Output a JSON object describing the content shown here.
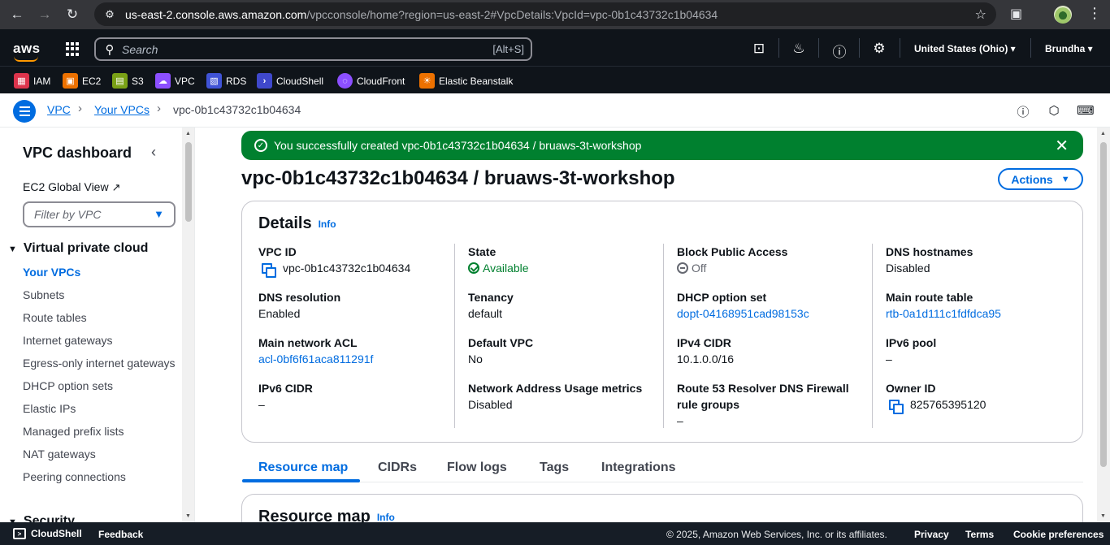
{
  "browser": {
    "url_host": "us-east-2.console.aws.amazon.com",
    "url_rest": "/vpcconsole/home?region=us-east-2#VpcDetails:VpcId=vpc-0b1c43732c1b04634"
  },
  "topnav": {
    "logo": "aws",
    "search_placeholder": "Search",
    "search_shortcut": "[Alt+S]",
    "region": "United States (Ohio)",
    "user": "Brundha"
  },
  "favorites": [
    {
      "label": "IAM",
      "color": "#dd344c",
      "icon": "iam-icon"
    },
    {
      "label": "EC2",
      "color": "#ed7100",
      "icon": "ec2-icon"
    },
    {
      "label": "S3",
      "color": "#7aa116",
      "icon": "s3-icon"
    },
    {
      "label": "VPC",
      "color": "#8c4fff",
      "icon": "vpc-icon"
    },
    {
      "label": "RDS",
      "color": "#4053d6",
      "icon": "rds-icon"
    },
    {
      "label": "CloudShell",
      "color": "#3f48cc",
      "icon": "cloudshell-icon"
    },
    {
      "label": "CloudFront",
      "color": "#8c4fff",
      "icon": "cloudfront-icon"
    },
    {
      "label": "Elastic Beanstalk",
      "color": "#ed7100",
      "icon": "beanstalk-icon"
    }
  ],
  "breadcrumb": {
    "items": [
      "VPC",
      "Your VPCs",
      "vpc-0b1c43732c1b04634"
    ]
  },
  "sidebar": {
    "title": "VPC dashboard",
    "ec2_global_view": "EC2 Global View",
    "filter_placeholder": "Filter by VPC",
    "section": "Virtual private cloud",
    "items": [
      "Your VPCs",
      "Subnets",
      "Route tables",
      "Internet gateways",
      "Egress-only internet gateways",
      "DHCP option sets",
      "Elastic IPs",
      "Managed prefix lists",
      "NAT gateways",
      "Peering connections"
    ],
    "section2": "Security"
  },
  "flash": {
    "message": "You successfully created vpc-0b1c43732c1b04634 / bruaws-3t-workshop"
  },
  "page": {
    "title": "vpc-0b1c43732c1b04634 / bruaws-3t-workshop",
    "actions_label": "Actions"
  },
  "details": {
    "title": "Details",
    "info": "Info",
    "vpc_id_label": "VPC ID",
    "vpc_id": "vpc-0b1c43732c1b04634",
    "state_label": "State",
    "state": "Available",
    "bpa_label": "Block Public Access",
    "bpa": "Off",
    "dns_hostnames_label": "DNS hostnames",
    "dns_hostnames": "Disabled",
    "dns_resolution_label": "DNS resolution",
    "dns_resolution": "Enabled",
    "tenancy_label": "Tenancy",
    "tenancy": "default",
    "dhcp_label": "DHCP option set",
    "dhcp": "dopt-04168951cad98153c",
    "main_rt_label": "Main route table",
    "main_rt": "rtb-0a1d111c1fdfdca95",
    "acl_label": "Main network ACL",
    "acl": "acl-0bf6f61aca811291f",
    "default_vpc_label": "Default VPC",
    "default_vpc": "No",
    "ipv4_label": "IPv4 CIDR",
    "ipv4": "10.1.0.0/16",
    "ipv6_pool_label": "IPv6 pool",
    "ipv6_pool": "–",
    "ipv6_cidr_label": "IPv6 CIDR",
    "ipv6_cidr": "–",
    "nau_label": "Network Address Usage metrics",
    "nau": "Disabled",
    "r53_label_1": "Route 53 Resolver DNS Firewall",
    "r53_label_2": "rule groups",
    "r53": "–",
    "owner_label": "Owner ID",
    "owner": "825765395120"
  },
  "tabs": [
    "Resource map",
    "CIDRs",
    "Flow logs",
    "Tags",
    "Integrations"
  ],
  "resource_map": {
    "title": "Resource map",
    "info": "Info"
  },
  "footer": {
    "cloudshell": "CloudShell",
    "feedback": "Feedback",
    "copyright": "© 2025, Amazon Web Services, Inc. or its affiliates.",
    "privacy": "Privacy",
    "terms": "Terms",
    "cookies": "Cookie preferences"
  }
}
